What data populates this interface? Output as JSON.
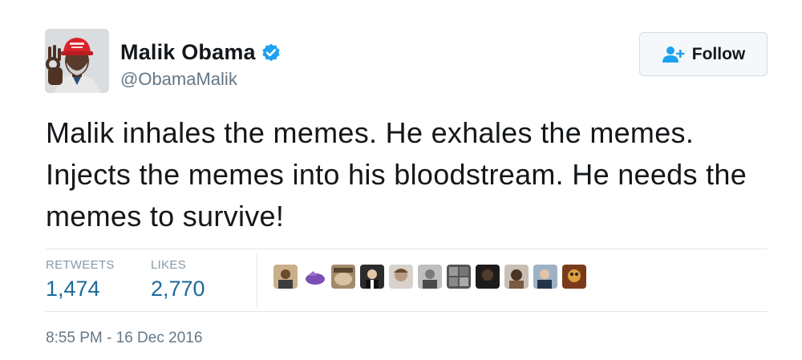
{
  "user": {
    "display_name": "Malik Obama",
    "handle": "@ObamaMalik",
    "verified_icon": "verified-badge-icon",
    "hat_text": "MAKE AMERICA GREAT AGAIN"
  },
  "follow_button": {
    "label": "Follow",
    "icon": "add-person-icon"
  },
  "tweet": {
    "text": "Malik inhales the memes. He exhales the memes. Injects the memes into his bloodstream. He needs the memes to survive!"
  },
  "stats": {
    "retweets_label": "RETWEETS",
    "retweets_value": "1,474",
    "likes_label": "LIKES",
    "likes_value": "2,770"
  },
  "timestamp": "8:55 PM - 16 Dec 2016",
  "colors": {
    "accent_blue": "#1da1f2",
    "stat_blue": "#1b6a9c",
    "muted_gray": "#657786"
  }
}
